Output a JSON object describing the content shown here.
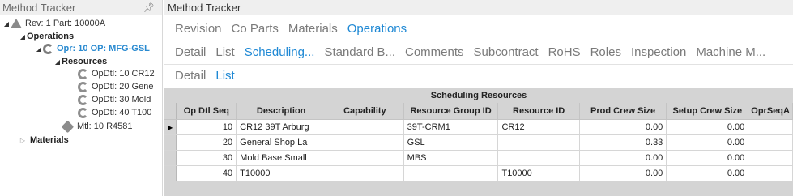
{
  "tree_panel": {
    "title": "Method Tracker",
    "pin_icon": "pin-icon",
    "nodes": {
      "rev": "Rev: 1 Part: 10000A",
      "operations": "Operations",
      "opr": "Opr: 10 OP: MFG-GSL",
      "resources": "Resources",
      "opdtl10": "OpDtl: 10 CR12",
      "opdtl20": "OpDtl: 20 Gene",
      "opdtl30": "OpDtl: 30 Mold",
      "opdtl40": "OpDtl: 40 T100",
      "mtl": "Mtl: 10 R4581",
      "materials": "Materials"
    }
  },
  "main": {
    "title": "Method Tracker",
    "tabs_level1": [
      "Revision",
      "Co Parts",
      "Materials",
      "Operations"
    ],
    "tabs_level1_active": 3,
    "tabs_level2": [
      "Detail",
      "List",
      "Scheduling...",
      "Standard B...",
      "Comments",
      "Subcontract",
      "RoHS",
      "Roles",
      "Inspection",
      "Machine M..."
    ],
    "tabs_level2_active": 2,
    "tabs_level3": [
      "Detail",
      "List"
    ],
    "tabs_level3_active": 1
  },
  "grid": {
    "caption": "Scheduling Resources",
    "columns": [
      "Op Dtl Seq",
      "Description",
      "Capability",
      "Resource Group ID",
      "Resource ID",
      "Prod Crew Size",
      "Setup Crew Size",
      "OprSeqA"
    ],
    "rows": [
      {
        "seq": "10",
        "description": "CR12 39T Arburg",
        "capability": "",
        "resource_group": "39T-CRM1",
        "resource_id": "CR12",
        "prod_crew": "0.00",
        "setup_crew": "0.00",
        "oprseq": ""
      },
      {
        "seq": "20",
        "description": "General Shop La",
        "capability": "",
        "resource_group": "GSL",
        "resource_id": "",
        "prod_crew": "0.33",
        "setup_crew": "0.00",
        "oprseq": ""
      },
      {
        "seq": "30",
        "description": "Mold Base Small",
        "capability": "",
        "resource_group": "MBS",
        "resource_id": "",
        "prod_crew": "0.00",
        "setup_crew": "0.00",
        "oprseq": ""
      },
      {
        "seq": "40",
        "description": "T10000",
        "capability": "",
        "resource_group": "",
        "resource_id": "T10000",
        "prod_crew": "0.00",
        "setup_crew": "0.00",
        "oprseq": ""
      }
    ],
    "current_row_marker": "▶"
  },
  "colors": {
    "accent": "#1e88d4",
    "selected_tree_text": "#2a8ad0",
    "grid_header": "#d4d4d4"
  }
}
